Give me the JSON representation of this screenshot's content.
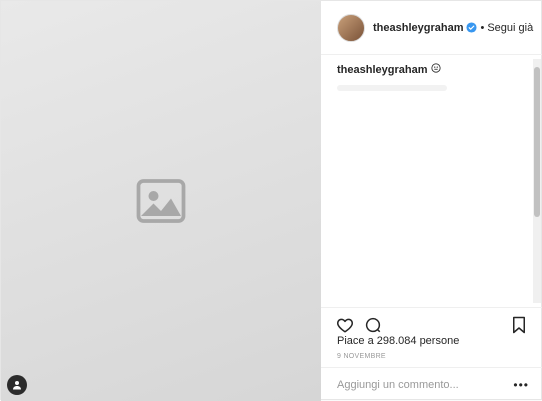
{
  "post": {
    "username": "theashleygraham",
    "follow_separator": "•",
    "follow_label": "Segui già",
    "caption_user": "theashleygraham",
    "caption_text": "",
    "likes_text": "Piace a 298.084 persone",
    "date_text": "9 NOVEMBRE",
    "comment_placeholder": "Aggiungi un commento...",
    "more_label": "•••"
  },
  "colors": {
    "verified": "#3897f0",
    "text": "#262626",
    "muted": "#999999"
  }
}
